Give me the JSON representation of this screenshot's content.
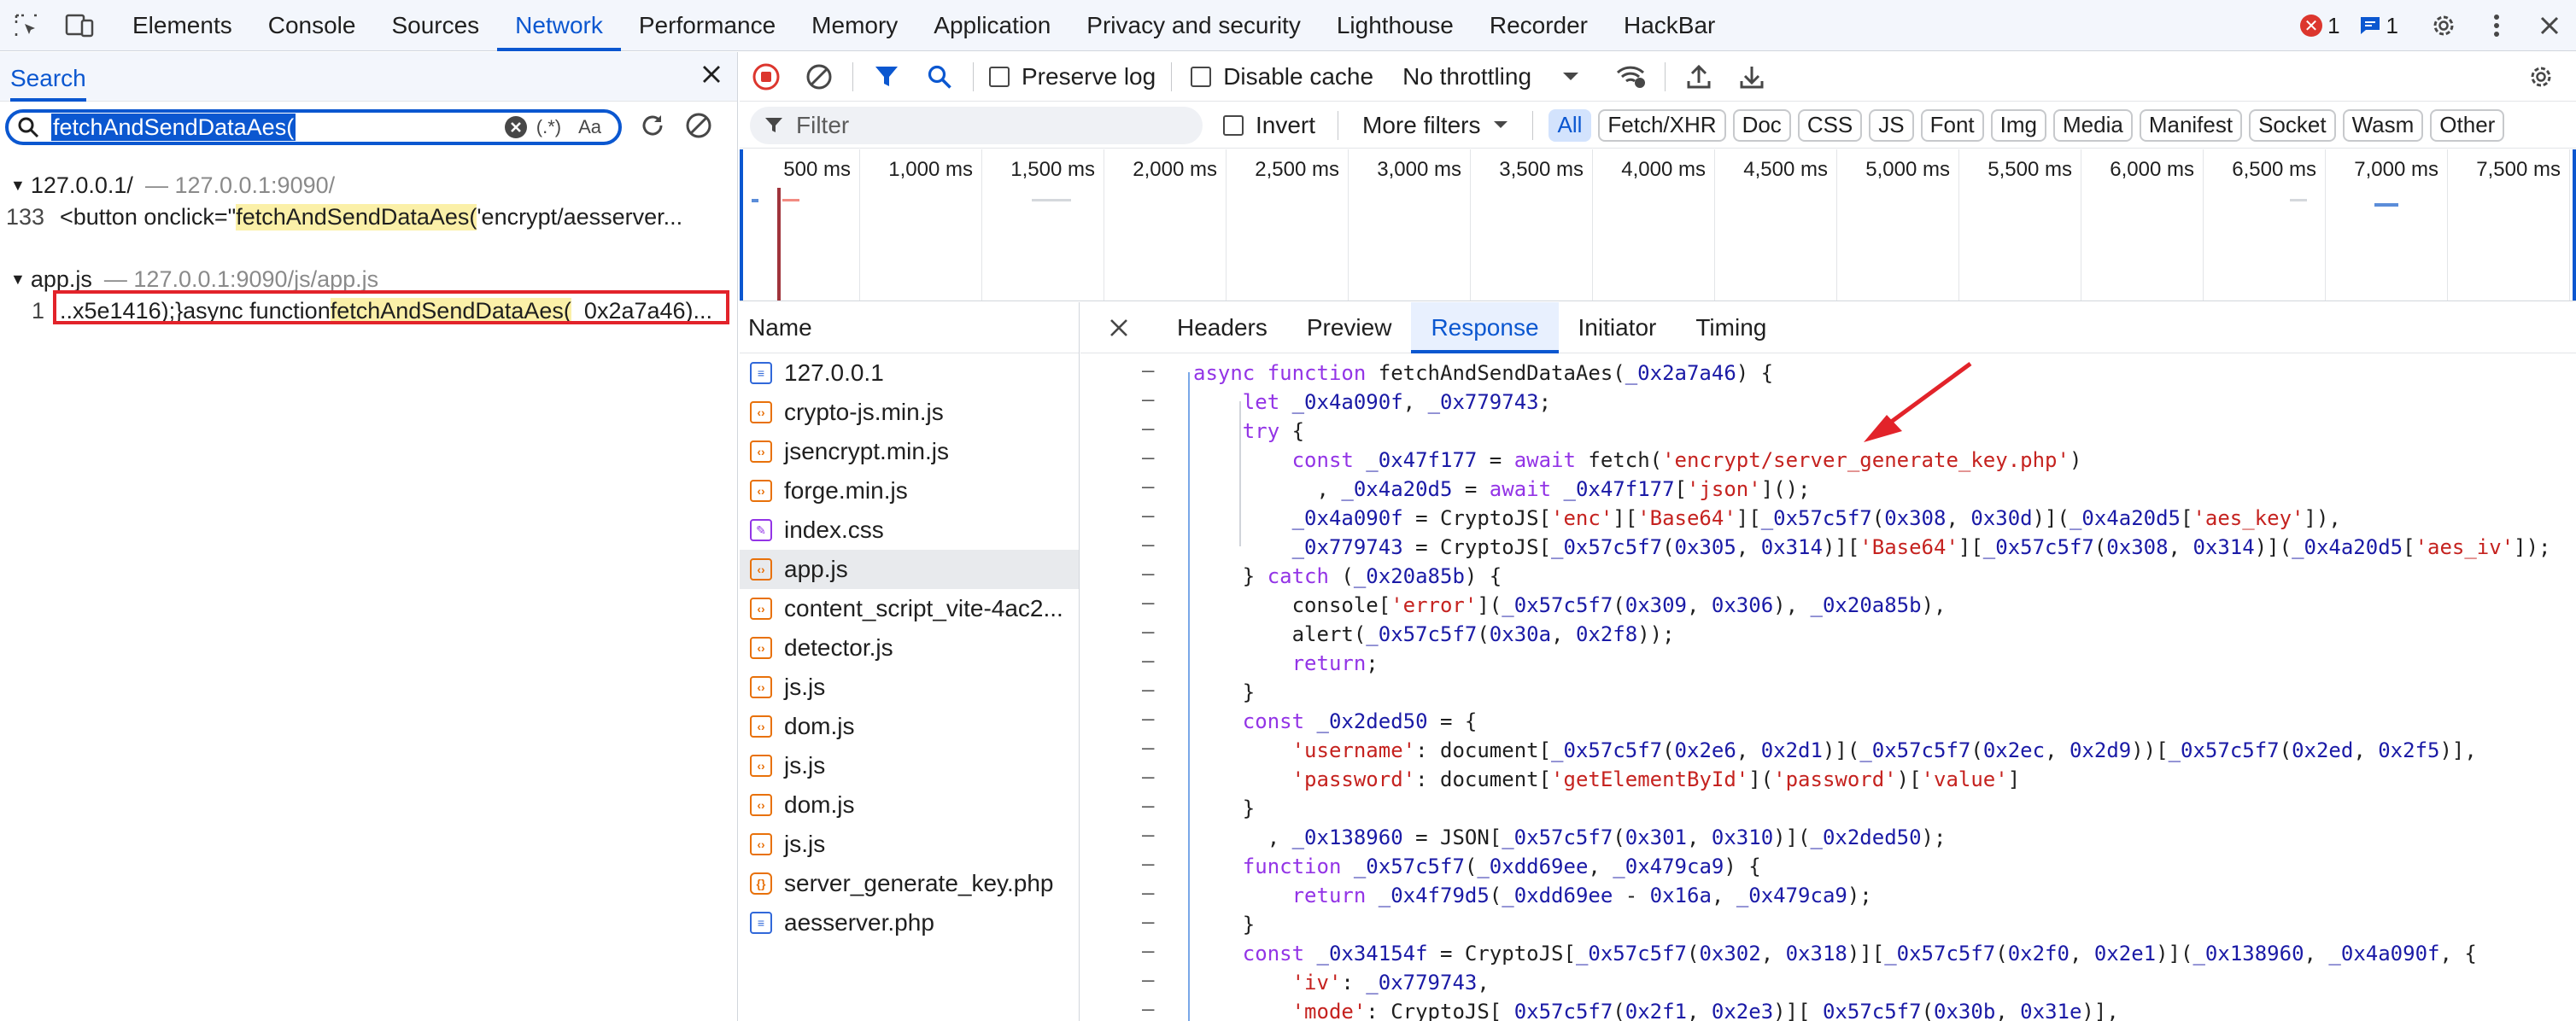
{
  "topbar": {
    "tabs": [
      "Elements",
      "Console",
      "Sources",
      "Network",
      "Performance",
      "Memory",
      "Application",
      "Privacy and security",
      "Lighthouse",
      "Recorder",
      "HackBar"
    ],
    "active_tab": "Network",
    "error_count": "1",
    "message_count": "1"
  },
  "search": {
    "title": "Search",
    "query": "fetchAndSendDataAes(",
    "regex_label": "(.*)",
    "case_label": "Aa",
    "groups": [
      {
        "file": "127.0.0.1/",
        "url": "127.0.0.1:9090/",
        "line": "133",
        "pre": "<button onclick=\"",
        "match": "fetchAndSendDataAes(",
        "post": "'encrypt/aesserver..."
      },
      {
        "file": "app.js",
        "url": "127.0.0.1:9090/js/app.js",
        "line": "1",
        "pre": "..x5e1416);}async function ",
        "match": "fetchAndSendDataAes(",
        "post": "_0x2a7a46)..."
      }
    ]
  },
  "toolbar": {
    "preserve_log": "Preserve log",
    "disable_cache": "Disable cache",
    "throttling": "No throttling"
  },
  "filterbar": {
    "filter_placeholder": "Filter",
    "invert": "Invert",
    "more_filters": "More filters",
    "chips": [
      "All",
      "Fetch/XHR",
      "Doc",
      "CSS",
      "JS",
      "Font",
      "Img",
      "Media",
      "Manifest",
      "Socket",
      "Wasm",
      "Other"
    ],
    "active_chip": "All"
  },
  "timeline": {
    "labels": [
      "500 ms",
      "1,000 ms",
      "1,500 ms",
      "2,000 ms",
      "2,500 ms",
      "3,000 ms",
      "3,500 ms",
      "4,000 ms",
      "4,500 ms",
      "5,000 ms",
      "5,500 ms",
      "6,000 ms",
      "6,500 ms",
      "7,000 ms",
      "7,500 ms"
    ]
  },
  "requests": {
    "header": "Name",
    "items": [
      {
        "name": "127.0.0.1",
        "type": "doc"
      },
      {
        "name": "crypto-js.min.js",
        "type": "script"
      },
      {
        "name": "jsencrypt.min.js",
        "type": "script"
      },
      {
        "name": "forge.min.js",
        "type": "script"
      },
      {
        "name": "index.css",
        "type": "style"
      },
      {
        "name": "app.js",
        "type": "script"
      },
      {
        "name": "content_script_vite-4ac2...",
        "type": "script"
      },
      {
        "name": "detector.js",
        "type": "script"
      },
      {
        "name": "js.js",
        "type": "script"
      },
      {
        "name": "dom.js",
        "type": "script"
      },
      {
        "name": "js.js",
        "type": "script"
      },
      {
        "name": "dom.js",
        "type": "script"
      },
      {
        "name": "js.js",
        "type": "script"
      },
      {
        "name": "server_generate_key.php",
        "type": "fetch"
      },
      {
        "name": "aesserver.php",
        "type": "doc"
      }
    ],
    "selected": "app.js"
  },
  "detail": {
    "tabs": [
      "Headers",
      "Preview",
      "Response",
      "Initiator",
      "Timing"
    ],
    "active_tab": "Response",
    "gutter_mark": "–",
    "code_lines": [
      "async function fetchAndSendDataAes(_0x2a7a46) {",
      "    let _0x4a090f, _0x779743;",
      "    try {",
      "        const _0x47f177 = await fetch('encrypt/server_generate_key.php')",
      "          , _0x4a20d5 = await _0x47f177['json']();",
      "        _0x4a090f = CryptoJS['enc']['Base64'][_0x57c5f7(0x308, 0x30d)](_0x4a20d5['aes_key']),",
      "        _0x779743 = CryptoJS[_0x57c5f7(0x305, 0x314)]['Base64'][_0x57c5f7(0x308, 0x314)](_0x4a20d5['aes_iv']);",
      "    } catch (_0x20a85b) {",
      "        console['error'](_0x57c5f7(0x309, 0x306), _0x20a85b),",
      "        alert(_0x57c5f7(0x30a, 0x2f8));",
      "        return;",
      "    }",
      "    const _0x2ded50 = {",
      "        'username': document[_0x57c5f7(0x2e6, 0x2d1)](_0x57c5f7(0x2ec, 0x2d9))[_0x57c5f7(0x2ed, 0x2f5)],",
      "        'password': document['getElementById']('password')['value']",
      "    }",
      "      , _0x138960 = JSON[_0x57c5f7(0x301, 0x310)](_0x2ded50);",
      "    function _0x57c5f7(_0xdd69ee, _0x479ca9) {",
      "        return _0x4f79d5(_0xdd69ee - 0x16a, _0x479ca9);",
      "    }",
      "    const _0x34154f = CryptoJS[_0x57c5f7(0x302, 0x318)][_0x57c5f7(0x2f0, 0x2e1)](_0x138960, _0x4a090f, {",
      "        'iv': _0x779743,",
      "        'mode': CryptoJS[_0x57c5f7(0x2f1, 0x2e3)][_0x57c5f7(0x30b, 0x31e)],"
    ]
  },
  "colors": {
    "accent": "#0b57d0",
    "highlight_box": "#e2232a",
    "arrow": "#e2232a",
    "record": "#dc362e"
  }
}
